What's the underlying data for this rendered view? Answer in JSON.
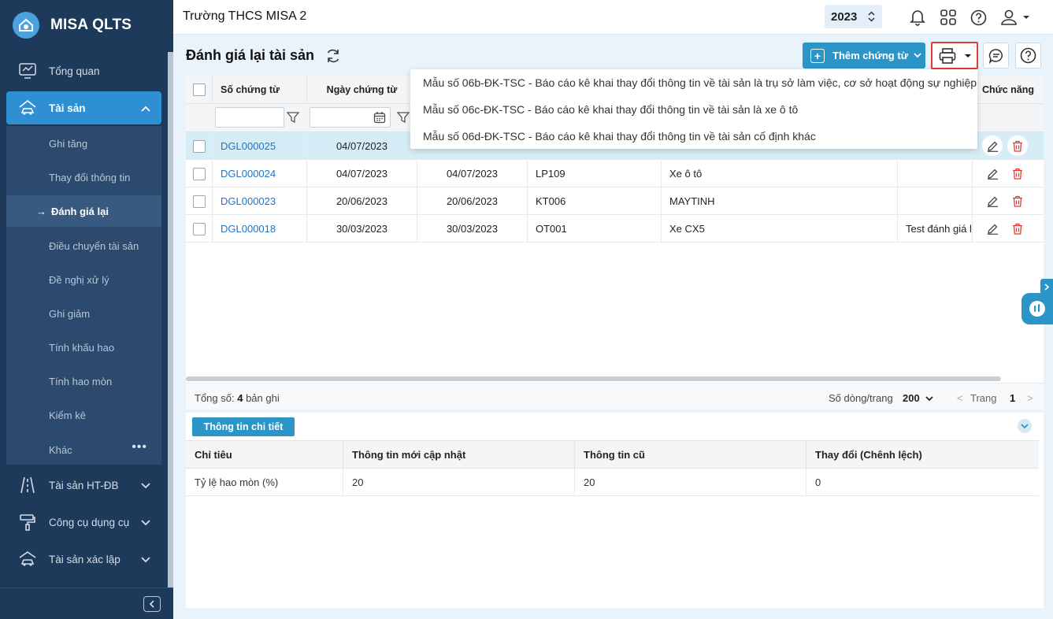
{
  "app": {
    "brand": "MISA QLTS",
    "school": "Trường THCS MISA 2",
    "year": "2023"
  },
  "sidebar": {
    "items": [
      {
        "label": "Tổng quan",
        "icon": "dashboard-icon"
      },
      {
        "label": "Tài sản",
        "icon": "house-car-icon"
      },
      {
        "label": "Tài sản HT-ĐB",
        "icon": "road-icon"
      },
      {
        "label": "Công cụ dụng cụ",
        "icon": "paint-roller-icon"
      },
      {
        "label": "Tài sản xác lập",
        "icon": "car-house-icon"
      }
    ],
    "sub_items": [
      {
        "label": "Ghi tăng"
      },
      {
        "label": "Thay đổi thông tin"
      },
      {
        "label": "Đánh giá lại",
        "current_prefix": "→"
      },
      {
        "label": "Điều chuyển tài sản"
      },
      {
        "label": "Đề nghị xử lý"
      },
      {
        "label": "Ghi giảm"
      },
      {
        "label": "Tính khấu hao"
      },
      {
        "label": "Tính hao mòn"
      },
      {
        "label": "Kiểm kê"
      },
      {
        "label": "Khác",
        "more": "•••"
      }
    ]
  },
  "page": {
    "title": "Đánh giá lại tài sản",
    "add_button": "Thêm chứng từ"
  },
  "table": {
    "columns": [
      "Số chứng từ",
      "Ngày chứng từ",
      "Chức năng"
    ],
    "rows": [
      {
        "code": "DGL000025",
        "date": "04/07/2023",
        "date2": "",
        "asset_code": "",
        "asset_name": "",
        "note": ""
      },
      {
        "code": "DGL000024",
        "date": "04/07/2023",
        "date2": "04/07/2023",
        "asset_code": "LP109",
        "asset_name": "Xe ô tô",
        "note": ""
      },
      {
        "code": "DGL000023",
        "date": "20/06/2023",
        "date2": "20/06/2023",
        "asset_code": "KT006",
        "asset_name": "MAYTINH",
        "note": ""
      },
      {
        "code": "DGL000018",
        "date": "30/03/2023",
        "date2": "30/03/2023",
        "asset_code": "OT001",
        "asset_name": "Xe CX5",
        "note": "Test đánh giá l"
      }
    ],
    "footer": {
      "total_prefix": "Tổng số:",
      "total_count": "4",
      "total_suffix": "bản ghi",
      "rows_per_page_label": "Số dòng/trang",
      "rows_per_page": "200",
      "prev": "<",
      "page_label": "Trang",
      "page": "1",
      "next": ">"
    }
  },
  "print_menu": [
    "Mẫu số 06b-ĐK-TSC - Báo cáo kê khai thay đổi thông tin về tài sản là trụ sở làm việc, cơ sở hoạt động sự nghiệp",
    "Mẫu số 06c-ĐK-TSC - Báo cáo kê khai thay đổi thông tin về tài sản là xe ô tô",
    "Mẫu số 06d-ĐK-TSC - Báo cáo kê khai thay đổi thông tin về tài sản cố định khác"
  ],
  "detail": {
    "tab": "Thông tin chi tiết",
    "columns": [
      "Chỉ tiêu",
      "Thông tin mới cập nhật",
      "Thông tin cũ",
      "Thay đổi (Chênh lệch)"
    ],
    "rows": [
      [
        "Tỷ lệ hao mòn (%)",
        "20",
        "20",
        "0"
      ]
    ]
  },
  "colors": {
    "sidebar_bg": "#1e3a5a",
    "accent": "#2c95c8",
    "link": "#1e74c8",
    "delete": "#e53935",
    "highlight_border": "#e53935"
  }
}
